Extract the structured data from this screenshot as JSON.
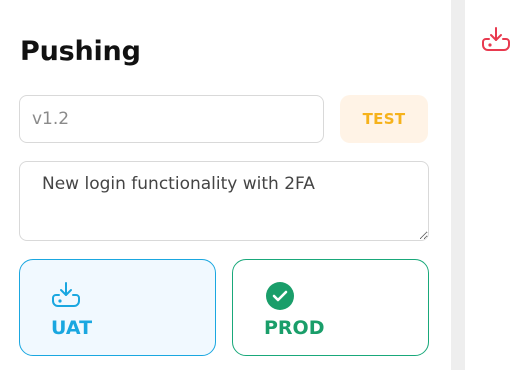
{
  "panel": {
    "title": "Pushing",
    "version_input": {
      "value": "v1.2",
      "placeholder": ""
    },
    "current_env_badge": "TEST",
    "notes_textarea": {
      "value": "New login functionality with 2FA"
    },
    "environments": [
      {
        "label": "UAT",
        "icon": "download-cloud-icon",
        "selected": true
      },
      {
        "label": "PROD",
        "icon": "check-circle-icon",
        "selected": false
      }
    ]
  },
  "sidebar": {
    "icon": "download-cloud-icon"
  },
  "colors": {
    "badge_text": "#f6b21b",
    "badge_bg": "#fff3e6",
    "uat_accent": "#1aa7e0",
    "prod_accent": "#1a9e6a",
    "side_icon": "#e83a4f"
  }
}
